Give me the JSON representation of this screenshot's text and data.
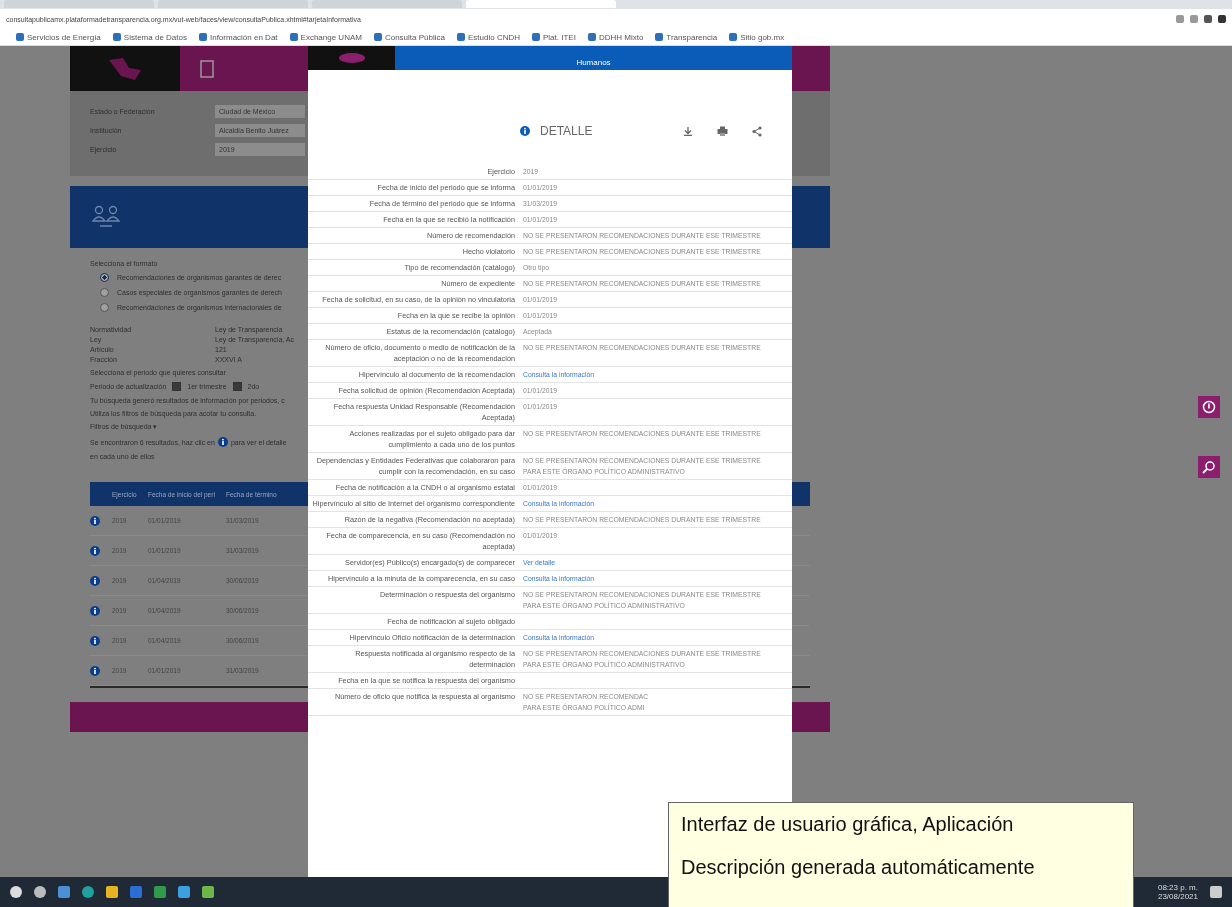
{
  "browser": {
    "tabs": [
      {
        "selected": false
      },
      {
        "selected": false
      },
      {
        "selected": false
      },
      {
        "selected": true
      }
    ],
    "address": "consultapublicamx.plataformadetransparencia.org.mx/vut-web/faces/view/consultaPublica.xhtml#tarjetaInformativa",
    "bookmarks": [
      "Servicios de Energía",
      "Sistema de Datos",
      "Información en Dat",
      "Exchange UNAM",
      "Consulta Pública",
      "Estudio CNDH",
      "Plat. ITEI",
      "DDHH Mixto",
      "Transparencia",
      "Sitio gob.mx"
    ]
  },
  "page": {
    "filters": [
      {
        "label": "Estado o Federación",
        "value": "Ciudad de México"
      },
      {
        "label": "Institución",
        "value": "Alcaldía Benito Juárez"
      },
      {
        "label": "Ejercicio",
        "value": "2019"
      }
    ],
    "format_title": "Selecciona el formato",
    "formats": [
      {
        "label": "Recomendaciones de organismos garantes de derec",
        "selected": true
      },
      {
        "label": "Casos especiales de organismos garantes de derech",
        "selected": false
      },
      {
        "label": "Recomendaciones de organismos internacionales de",
        "selected": false
      }
    ],
    "info": [
      {
        "label": "Normatividad",
        "value": "Ley de Transparencia"
      },
      {
        "label": "Ley",
        "value": "Ley de Transparencia, Ac"
      },
      {
        "label": "Artículo",
        "value": "121"
      },
      {
        "label": "Fracción",
        "value": "XXXVI A"
      }
    ],
    "period_title": "Selecciona el periodo que quieres consultar",
    "period_label": "Periodo de actualización",
    "periods": [
      {
        "label": "1er trimestre",
        "checked": true
      },
      {
        "label": "2do",
        "checked": true
      }
    ],
    "notes": [
      "Tu búsqueda generó resultados de información por periodos, c",
      "Utiliza los filtros de búsqueda para acotar tu consulta."
    ],
    "filters_link": "Filtros de búsqueda ▾",
    "results_before": "Se encontraron 6 resultados, haz clic en",
    "results_after": "para ver el detalle",
    "results_line2": "en cada uno de ellos",
    "table_columns": [
      "Ejercicio",
      "Fecha de inicio del peri",
      "Fecha de término"
    ],
    "table_rows": [
      [
        "2019",
        "01/01/2019",
        "31/03/2019"
      ],
      [
        "2019",
        "01/01/2019",
        "31/03/2019"
      ],
      [
        "2019",
        "01/04/2019",
        "30/06/2019"
      ],
      [
        "2019",
        "01/04/2019",
        "30/06/2019"
      ],
      [
        "2019",
        "01/04/2019",
        "30/06/2019"
      ],
      [
        "2019",
        "01/01/2019",
        "31/03/2019"
      ]
    ]
  },
  "modal": {
    "banner": "Humanos",
    "title": "DETALLE",
    "rows": [
      {
        "label": "Ejercicio",
        "kind": "text",
        "lines": [
          "2019"
        ]
      },
      {
        "label": "Fecha de inicio del periodo que se informa",
        "kind": "text",
        "lines": [
          "01/01/2019"
        ]
      },
      {
        "label": "Fecha de término del periodo que se informa",
        "kind": "text",
        "lines": [
          "31/03/2019"
        ]
      },
      {
        "label": "Fecha en la que se recibió la notificación",
        "kind": "text",
        "lines": [
          "01/01/2019"
        ]
      },
      {
        "label": "Número de recomendación",
        "kind": "text",
        "lines": [
          "NO SE PRESENTARON RECOMENDACIONES DURANTE ESE TRIMESTRE"
        ]
      },
      {
        "label": "Hecho violatorio",
        "kind": "text",
        "lines": [
          "NO SE PRESENTARON RECOMENDACIONES DURANTE ESE TRIMESTRE"
        ]
      },
      {
        "label": "Tipo de recomendación (catálogo)",
        "kind": "text",
        "lines": [
          "Otro tipo"
        ]
      },
      {
        "label": "Número de expediente",
        "kind": "text",
        "lines": [
          "NO SE PRESENTARON RECOMENDACIONES DURANTE ESE TRIMESTRE"
        ]
      },
      {
        "label": "Fecha de solicitud, en su caso, de la opinión no vinculatoria",
        "kind": "text",
        "lines": [
          "01/01/2019"
        ]
      },
      {
        "label": "Fecha en la que se recibe la opinión",
        "kind": "text",
        "lines": [
          "01/01/2019"
        ]
      },
      {
        "label": "Estatus de la recomendación (catálogo)",
        "kind": "text",
        "lines": [
          "Aceptada"
        ]
      },
      {
        "label": "Número de oficio, documento o medio de notificación de la aceptación o no de la recomendación",
        "kind": "text",
        "lines": [
          "NO SE PRESENTARON RECOMENDACIONES DURANTE ESE TRIMESTRE"
        ]
      },
      {
        "label": "Hipervínculo al documento de la recomendación",
        "kind": "link",
        "lines": [
          "Consulta la información"
        ]
      },
      {
        "label": "Fecha solicitud de opinión (Recomendación Aceptada)",
        "kind": "text",
        "lines": [
          "01/01/2019"
        ]
      },
      {
        "label": "Fecha respuesta Unidad Responsable (Recomendación Aceptada)",
        "kind": "text",
        "lines": [
          "01/01/2019"
        ]
      },
      {
        "label": "Acciones realizadas por el sujeto obligado para dar cumplimiento a cada uno de los puntos",
        "kind": "text",
        "lines": [
          "NO SE PRESENTARON RECOMENDACIONES DURANTE ESE TRIMESTRE"
        ]
      },
      {
        "label": "Dependencias y Entidades Federativas que colaboraron para cumplir con la recomendación, en su caso",
        "kind": "text",
        "lines": [
          "NO SE PRESENTARON RECOMENDACIONES DURANTE ESE TRIMESTRE",
          "PARA ESTE ÓRGANO POLÍTICO ADMINISTRATIVO"
        ]
      },
      {
        "label": "Fecha de notificación a la CNDH o al organismo estatal",
        "kind": "text",
        "lines": [
          "01/01/2019"
        ]
      },
      {
        "label": "Hipervínculo al sitio de Internet del organismo correspondiente",
        "kind": "link",
        "lines": [
          "Consulta la información"
        ]
      },
      {
        "label": "Razón de la negativa (Recomendación no aceptada)",
        "kind": "text",
        "lines": [
          "NO SE PRESENTARON RECOMENDACIONES DURANTE ESE TRIMESTRE"
        ]
      },
      {
        "label": "Fecha de comparecencia, en su caso (Recomendación no aceptada)",
        "kind": "text",
        "lines": [
          "01/01/2019"
        ]
      },
      {
        "label": "Servidor(es) Público(s) encargado(s) de comparecer",
        "kind": "link",
        "lines": [
          "Ver detalle"
        ]
      },
      {
        "label": "Hipervínculo a la minuta de la comparecencia, en su caso",
        "kind": "link",
        "lines": [
          "Consulta la información"
        ]
      },
      {
        "label": "Determinación o respuesta del organismo",
        "kind": "text",
        "lines": [
          "NO SE PRESENTARON RECOMENDACIONES DURANTE ESE TRIMESTRE",
          "PARA ESTE ÓRGANO POLÍTICO ADMINISTRATIVO"
        ]
      },
      {
        "label": "Fecha de notificación al sujeto obligado",
        "lines": []
      },
      {
        "label": "Hipervínculo Oficio notificación de la determinación",
        "kind": "link",
        "lines": [
          "Consulta la información"
        ]
      },
      {
        "label": "Respuesta notificada al organismo respecto de la determinación",
        "kind": "text",
        "lines": [
          "NO SE PRESENTARON RECOMENDACIONES DURANTE ESE TRIMESTRE",
          "PARA ESTE ÓRGANO POLÍTICO ADMINISTRATIVO"
        ]
      },
      {
        "label": "Fecha en la que se notifica la respuesta del organismo",
        "lines": []
      },
      {
        "label": "Número de oficio que notifica la respuesta al organismo",
        "kind": "text",
        "lines": [
          "NO SE PRESENTARON RECOMENDAC",
          "PARA ESTE ÓRGANO POLÍTICO ADMI"
        ]
      }
    ]
  },
  "taskbar": {
    "time": "08:23 p. m.",
    "date": "23/08/2021"
  },
  "tooltip": {
    "title": "Interfaz de usuario gráfica, Aplicación",
    "description": "Descripción generada automáticamente"
  }
}
